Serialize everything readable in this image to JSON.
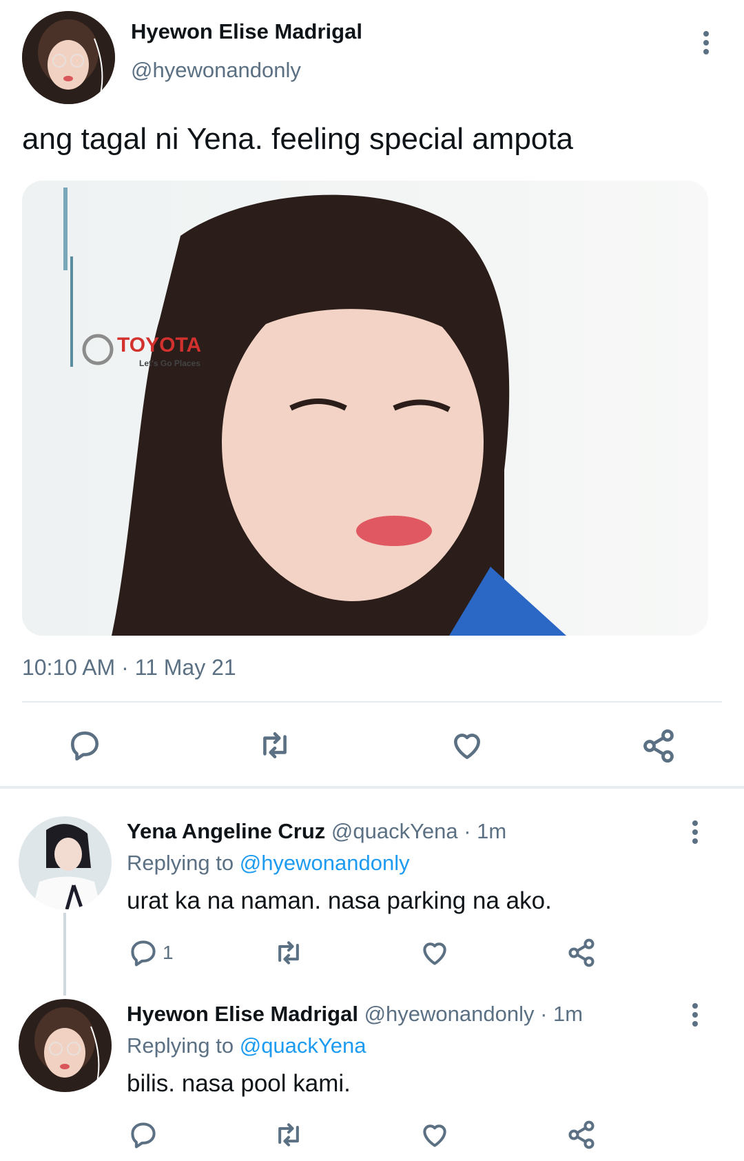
{
  "main_tweet": {
    "author_name": "Hyewon Elise Madrigal",
    "author_handle": "@hyewonandonly",
    "text": "ang tagal ni Yena. feeling special ampota",
    "timestamp": "10:10 AM · 11 May 21",
    "media_overlay_text": "TOYOTA",
    "media_overlay_sub": "Let's Go Places"
  },
  "replies": [
    {
      "author_name": "Yena Angeline Cruz",
      "author_handle": "@quackYena",
      "time": "· 1m",
      "replying_prefix": "Replying to",
      "replying_handle": "@hyewonandonly",
      "text": "urat ka na naman. nasa parking na ako.",
      "reply_count": "1"
    },
    {
      "author_name": "Hyewon Elise Madrigal",
      "author_handle": "@hyewonandonly",
      "time": "· 1m",
      "replying_prefix": "Replying to",
      "replying_handle": "@quackYena",
      "text": "bilis. nasa pool kami.",
      "reply_count": ""
    }
  ],
  "colors": {
    "link": "#1d9bf0",
    "muted": "#5b7083",
    "divider": "#e6ecf0"
  },
  "icons": [
    "reply-icon",
    "retweet-icon",
    "like-icon",
    "share-icon",
    "more-icon"
  ]
}
